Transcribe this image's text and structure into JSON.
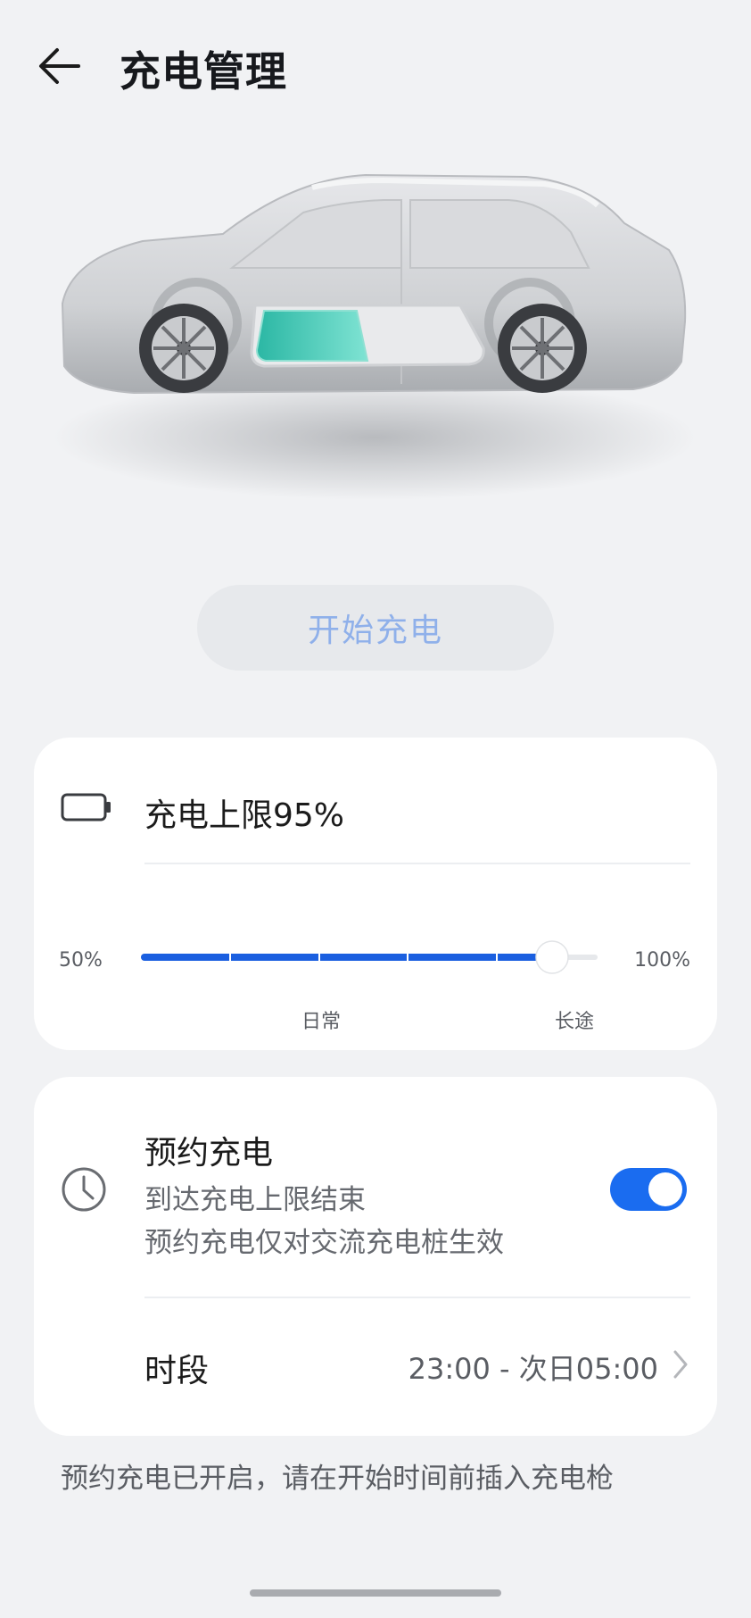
{
  "header": {
    "title": "充电管理",
    "back_icon": "arrow-left-icon"
  },
  "start_button": {
    "label": "开始充电",
    "color": "#8fb0ea"
  },
  "charge_limit": {
    "icon": "battery-icon",
    "title": "充电上限95%",
    "slider": {
      "min_label": "50%",
      "max_label": "100%",
      "value_percent": 95,
      "min": 50,
      "max": 100,
      "tick_labels": [
        "日常",
        "长途"
      ],
      "accent_color": "#1a5fe0"
    }
  },
  "scheduled_charging": {
    "icon": "clock-icon",
    "title": "预约充电",
    "subtitle_1": "到达充电上限结束",
    "subtitle_2": "预约充电仅对交流充电桩生效",
    "enabled": true,
    "toggle_color": "#1a6cf0",
    "period_label": "时段",
    "period_value": "23:00 - 次日05:00"
  },
  "footnote": "预约充电已开启，请在开始时间前插入充电枪"
}
